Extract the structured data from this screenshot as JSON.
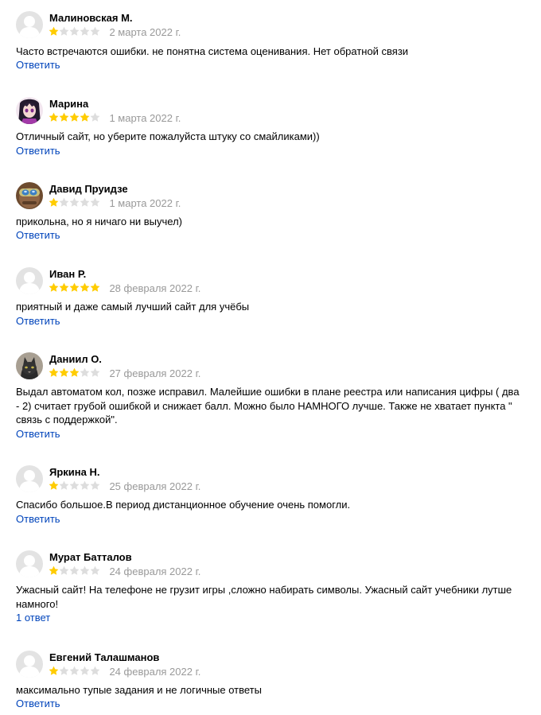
{
  "colors": {
    "star_filled": "#ffcc00",
    "star_empty": "#dddddd",
    "date": "#999999",
    "link": "#0044bb",
    "avatar_placeholder": "#d6d6d6"
  },
  "reviews": [
    {
      "author": "Малиновская М.",
      "rating": 1,
      "date": "2 марта 2022 г.",
      "text": "Часто встречаются ошибки. не понятна система оценивания. Нет обратной связи",
      "action": "Ответить",
      "avatar": "placeholder"
    },
    {
      "author": "Марина",
      "rating": 4,
      "date": "1 марта 2022 г.",
      "text": "Отличный сайт, но уберите пожалуйста штуку со смайликами))",
      "action": "Ответить",
      "avatar": "anime-girl-photo"
    },
    {
      "author": "Давид Пруидзе",
      "rating": 1,
      "date": "1 марта 2022 г.",
      "text": "прикольна, но я ничаго ни выучел)",
      "action": "Ответить",
      "avatar": "goggles-photo"
    },
    {
      "author": "Иван Р.",
      "rating": 5,
      "date": "28 февраля 2022 г.",
      "text": "приятный и даже самый лучший сайт для учёбы",
      "action": "Ответить",
      "avatar": "placeholder"
    },
    {
      "author": "Даниил О.",
      "rating": 3,
      "date": "27 февраля 2022 г.",
      "text": "Выдал автоматом кол, позже исправил. Малейшие ошибки в плане реестра или написания цифры ( два - 2) считает грубой ошибкой и снижает балл. Можно было НАМНОГО лучше. Также не хватает пункта \" связь с поддержкой\".",
      "action": "Ответить",
      "avatar": "cat-photo"
    },
    {
      "author": "Яркина Н.",
      "rating": 1,
      "date": "25 февраля 2022 г.",
      "text": "Спасибо большое.В период дистанционное обучение очень помогли.",
      "action": "Ответить",
      "avatar": "placeholder"
    },
    {
      "author": "Мурат Батталов",
      "rating": 1,
      "date": "24 февраля 2022 г.",
      "text": "Ужасный сайт! На телефоне не грузит игры ,сложно набирать символы. Ужасный сайт учебники лутше намного!",
      "action": "1 ответ",
      "avatar": "placeholder"
    },
    {
      "author": "Евгений Талашманов",
      "rating": 1,
      "date": "24 февраля 2022 г.",
      "text": "максимально тупые задания и не логичные ответы",
      "action": "Ответить",
      "avatar": "placeholder"
    }
  ]
}
